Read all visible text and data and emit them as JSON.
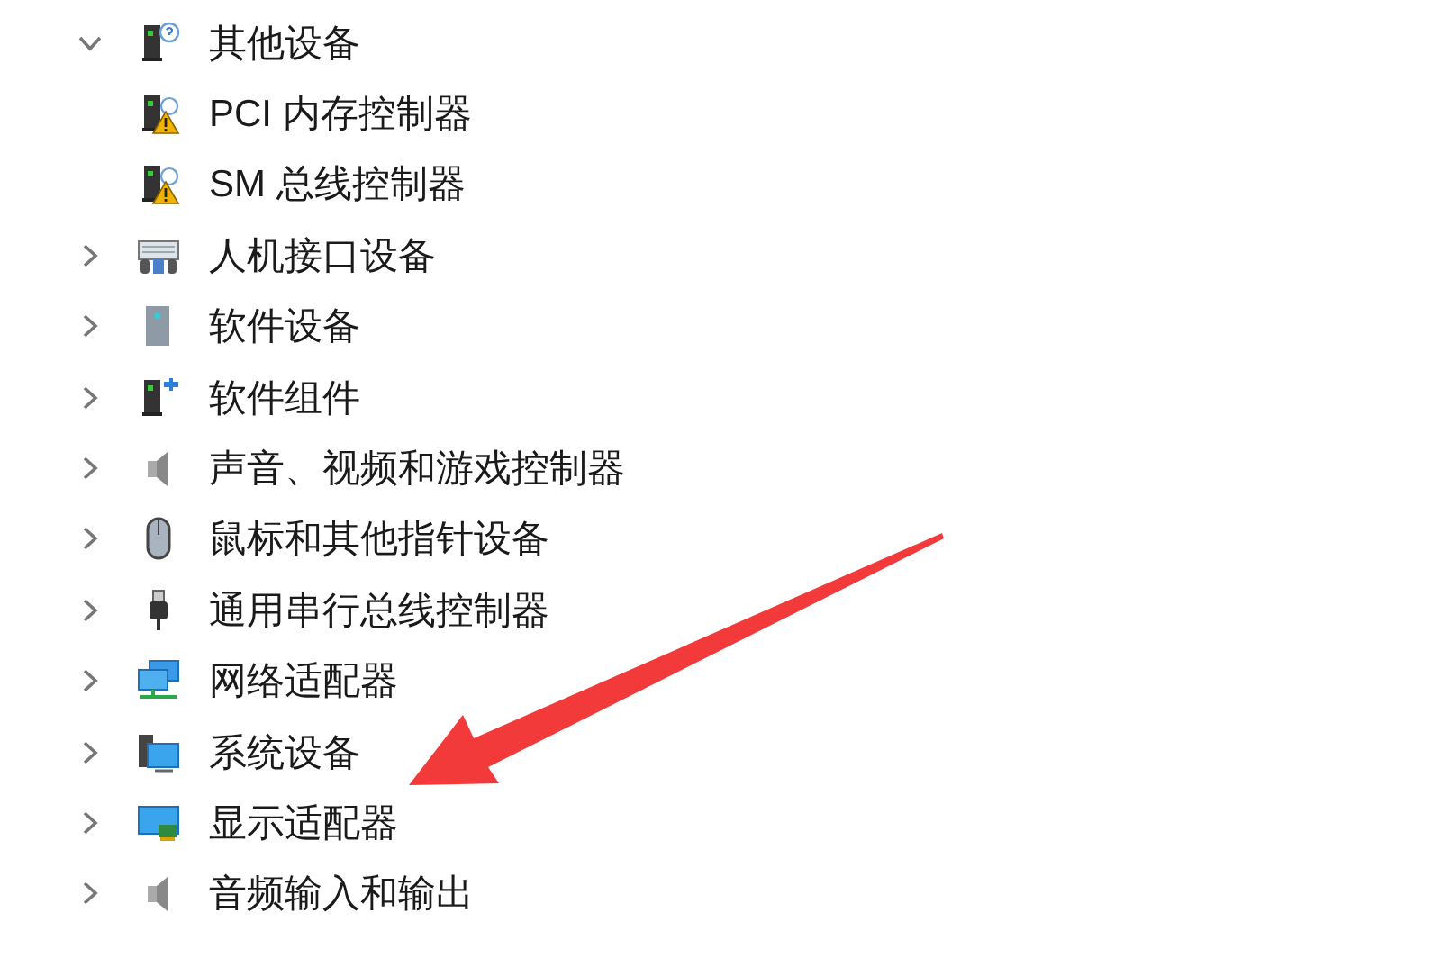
{
  "tree": [
    {
      "label": "其他设备",
      "kind": "unknown",
      "expanded": true,
      "children": [
        {
          "label": "PCI 内存控制器",
          "kind": "warning"
        },
        {
          "label": "SM 总线控制器",
          "kind": "warning"
        }
      ]
    },
    {
      "label": "人机接口设备",
      "kind": "hid",
      "expanded": false
    },
    {
      "label": "软件设备",
      "kind": "software",
      "expanded": false
    },
    {
      "label": "软件组件",
      "kind": "component",
      "expanded": false
    },
    {
      "label": "声音、视频和游戏控制器",
      "kind": "speaker",
      "expanded": false
    },
    {
      "label": "鼠标和其他指针设备",
      "kind": "mouse",
      "expanded": false
    },
    {
      "label": "通用串行总线控制器",
      "kind": "usb",
      "expanded": false
    },
    {
      "label": "网络适配器",
      "kind": "network",
      "expanded": false
    },
    {
      "label": "系统设备",
      "kind": "system",
      "expanded": false
    },
    {
      "label": "显示适配器",
      "kind": "display",
      "expanded": false
    },
    {
      "label": "音频输入和输出",
      "kind": "speaker",
      "expanded": false
    }
  ]
}
